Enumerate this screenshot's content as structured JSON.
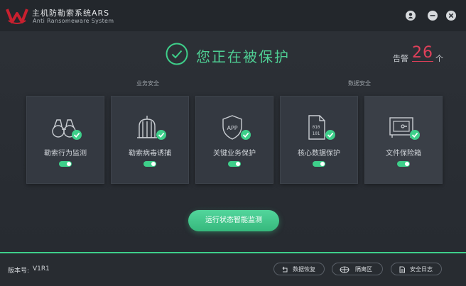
{
  "app": {
    "title": "主机防勒索系统ARS",
    "subtitle": "Anti Ransomeware System",
    "colors": {
      "accent": "#3ecf8a",
      "alarm": "#e0405a",
      "logo": "#c8202f"
    }
  },
  "window_controls": [
    "user-icon",
    "minimize-icon",
    "close-icon"
  ],
  "status": {
    "text": "您正在被保护",
    "alarm_label": "告警",
    "alarm_count": "26",
    "alarm_unit": "个"
  },
  "sections": {
    "business": "业务安全",
    "data": "数据安全"
  },
  "cards": [
    {
      "label": "勒索行为监测",
      "icon": "binoculars-icon",
      "enabled": true
    },
    {
      "label": "勒索病毒诱捕",
      "icon": "cage-icon",
      "enabled": true
    },
    {
      "label": "关键业务保护",
      "icon": "app-shield-icon",
      "enabled": true
    },
    {
      "label": "核心数据保护",
      "icon": "data-file-icon",
      "enabled": true
    },
    {
      "label": "文件保险箱",
      "icon": "safe-icon",
      "enabled": true
    }
  ],
  "main_button": "运行状态智能监测",
  "footer": {
    "version_label": "版本号:",
    "version_value": "V1R1",
    "buttons": [
      {
        "label": "数据恢复",
        "icon": "restore-icon"
      },
      {
        "label": "隔离区",
        "icon": "quarantine-icon"
      },
      {
        "label": "安全日志",
        "icon": "log-icon"
      }
    ]
  }
}
